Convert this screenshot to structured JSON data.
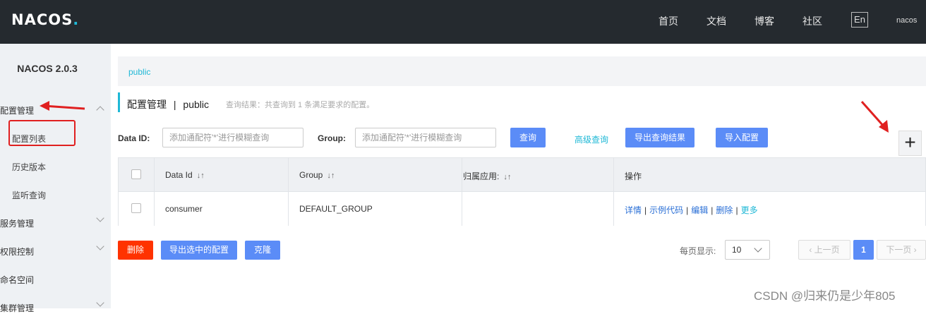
{
  "header": {
    "logo_text": "NACOS",
    "logo_dot": ".",
    "nav": [
      "首页",
      "文档",
      "博客",
      "社区"
    ],
    "lang": "En",
    "user": "nacos"
  },
  "sidebar": {
    "version": "NACOS 2.0.3",
    "config_mgmt": "配置管理",
    "config_list": "配置列表",
    "history": "历史版本",
    "listen_query": "监听查询",
    "service_mgmt": "服务管理",
    "auth_control": "权限控制",
    "namespace": "命名空间",
    "cluster_mgmt": "集群管理"
  },
  "breadcrumb": "public",
  "title": {
    "main": "配置管理",
    "sep": "|",
    "namespace": "public",
    "result": "查询结果：共查询到 1 条满足要求的配置。"
  },
  "search": {
    "data_id_label": "Data ID:",
    "data_id_placeholder": "添加通配符'*'进行模糊查询",
    "group_label": "Group:",
    "group_placeholder": "添加通配符'*'进行模糊查询",
    "query_btn": "查询",
    "advanced": "高级查询",
    "export_result": "导出查询结果",
    "import_config": "导入配置",
    "add_icon": "plus-icon"
  },
  "table": {
    "headers": [
      "Data Id",
      "Group",
      "归属应用:",
      "操作"
    ],
    "rows": [
      {
        "data_id": "consumer",
        "group": "DEFAULT_GROUP",
        "app": "",
        "ops": [
          "详情",
          "示例代码",
          "编辑",
          "删除",
          "更多"
        ]
      }
    ]
  },
  "footer": {
    "delete": "删除",
    "export_selected": "导出选中的配置",
    "clone": "克隆",
    "per_page_label": "每页显示:",
    "per_page_value": "10",
    "prev": "上一页",
    "current_page": "1",
    "next": "下一页"
  },
  "watermark": "CSDN @归来仍是少年805",
  "colors": {
    "accent": "#1fb8d6",
    "primary": "#5b8cf7",
    "danger": "#ff3300",
    "header_bg": "#252a2f",
    "annotation": "#e02020"
  }
}
